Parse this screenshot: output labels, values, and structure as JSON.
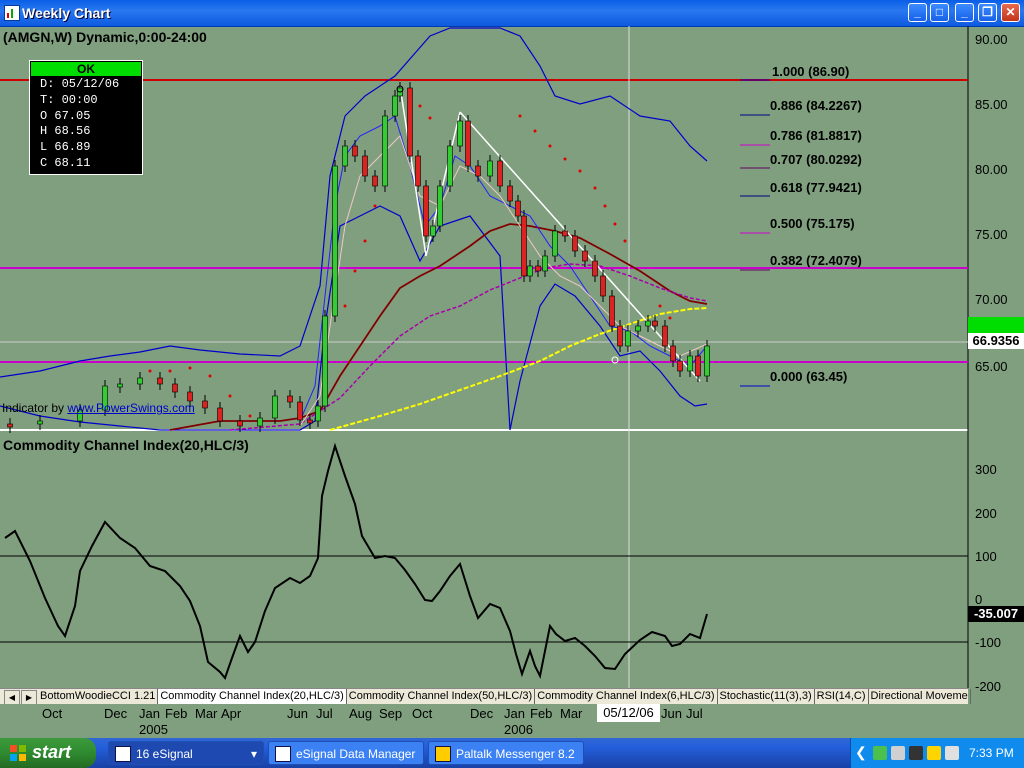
{
  "window": {
    "title": "Weekly Chart",
    "minimize": "_",
    "maximize": "□",
    "close": "✕"
  },
  "chart": {
    "title": "(AMGN,W) Dynamic,0:00-24:00",
    "info_box": {
      "status": "OK",
      "date": "D: 05/12/06",
      "time": "T: 00:00",
      "open": "O 67.05",
      "high": "H 68.56",
      "low": "L 66.89",
      "close": "C 68.11"
    },
    "indicator_credit": {
      "prefix": "Indicator by ",
      "link": "www.PowerSwings.com"
    },
    "cci_title": "Commodity Channel Index(20,HLC/3)",
    "price_axis_labels": [
      "90.00",
      "85.00",
      "80.00",
      "75.00",
      "70.00",
      "65.00"
    ],
    "cci_axis_labels": [
      "300",
      "200",
      "100",
      "0",
      "-100",
      "-200"
    ],
    "current_price": "66.9356",
    "current_price_hidden": "68.11",
    "current_cci": "-35.007",
    "fib_levels": [
      {
        "label": "1.000 (86.90)",
        "color": "#0000cc"
      },
      {
        "label": "0.886 (84.2267)",
        "color": "#000080"
      },
      {
        "label": "0.786 (81.8817)",
        "color": "#cc00cc"
      },
      {
        "label": "0.707 (80.0292)",
        "color": "#660066"
      },
      {
        "label": "0.618 (77.9421)",
        "color": "#000080"
      },
      {
        "label": "0.500 (75.175)",
        "color": "#cc00cc"
      },
      {
        "label": "0.382 (72.4079)",
        "color": "#660066"
      },
      {
        "label": "0.000 (63.45)",
        "color": "#0000cc"
      }
    ]
  },
  "tabs": [
    "BottomWoodieCCI 1.21",
    "Commodity Channel Index(20,HLC/3)",
    "Commodity Channel Index(50,HLC/3)",
    "Commodity Channel Index(6,HLC/3)",
    "Stochastic(11(3),3)",
    "RSI(14,C)",
    "Directional Moveme"
  ],
  "x_axis": {
    "months": [
      "Oct",
      "Dec",
      "Jan",
      "Feb",
      "Mar",
      "Apr",
      "Jun",
      "Jul",
      "Aug",
      "Sep",
      "Oct",
      "Dec",
      "Jan",
      "Feb",
      "Mar",
      "Jun",
      "Jul"
    ],
    "years": [
      "2005",
      "2006"
    ],
    "crosshair_date": "05/12/06"
  },
  "taskbar": {
    "start": "start",
    "tasks": [
      {
        "label": "16  eSignal",
        "arrow": "▾"
      },
      {
        "label": "eSignal Data Manager"
      },
      {
        "label": "Paltalk Messenger 8.2"
      }
    ],
    "clock": "7:33 PM"
  },
  "colors": {
    "chart_bg": "#7f9f7f",
    "fib_line_red": "#cc0000",
    "fib_line_magenta": "#cc00cc",
    "bollinger": "#0000cc",
    "ma_dark": "#800000",
    "ma_purple": "#aa00aa",
    "ma_yellow": "#ffff00"
  }
}
